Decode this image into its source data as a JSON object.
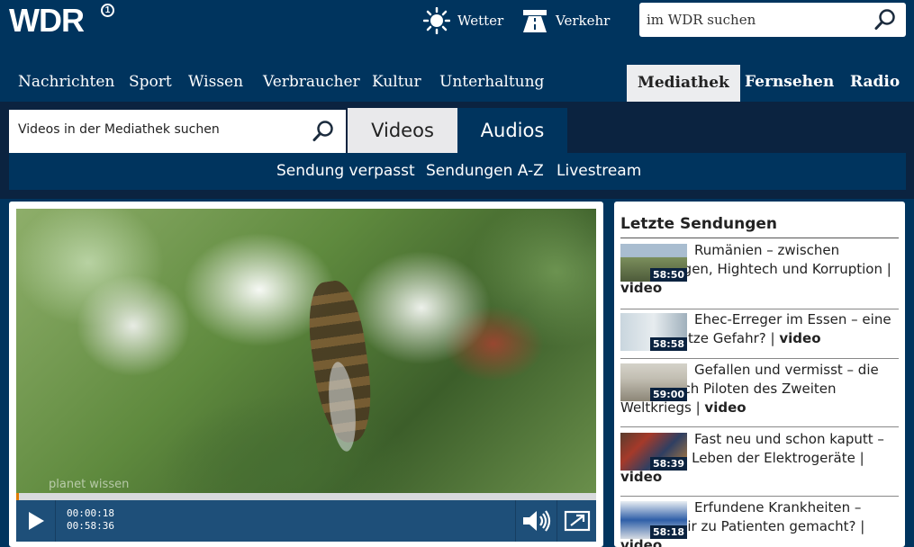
{
  "brand": {
    "logo": "WDR",
    "logo_mark": "1"
  },
  "top_links": [
    {
      "label": "Wetter",
      "icon": "sun-icon"
    },
    {
      "label": "Verkehr",
      "icon": "road-icon"
    }
  ],
  "site_search": {
    "value": "im WDR suchen",
    "icon": "search-icon"
  },
  "main_nav": {
    "items": [
      "Nachrichten",
      "Sport",
      "Wissen",
      "Verbraucher",
      "Kultur",
      "Unterhaltung"
    ],
    "mediathek": "Mediathek",
    "fernsehen": "Fernsehen",
    "radio": "Radio"
  },
  "mediathek": {
    "search_value": "Videos in der Mediathek suchen",
    "tab_videos": "Videos",
    "tab_audios": "Audios",
    "subnav": [
      "Sendung verpasst",
      "Sendungen A-Z",
      "Livestream"
    ]
  },
  "player": {
    "watermark": "planet wissen",
    "current_time": "00:00:18",
    "total_time": "00:58:36",
    "progress_fraction": 0.005,
    "accent_color": "#e07b00"
  },
  "sidebar": {
    "title": "Letzte Sendungen",
    "items": [
      {
        "title": "Rumänien – zwischen Pferdewagen, Hightech und Korruption",
        "sep": " | ",
        "kind": "video",
        "duration": "58:50"
      },
      {
        "title": "Ehec-Erreger im Essen – eine unterschätze Gefahr?",
        "sep": " | ",
        "kind": "video",
        "duration": "58:58"
      },
      {
        "title": "Gefallen und vermisst – die Suche nach Piloten des Zweiten Weltkriegs",
        "sep": " | ",
        "kind": "video",
        "duration": "59:00"
      },
      {
        "title": "Fast neu und schon kaputt – Das kurze Leben der Elektrogeräte",
        "sep": " | ",
        "kind": "video",
        "duration": "58:39"
      },
      {
        "title": "Erfundene Krankheiten – Werden wir zu Patienten gemacht?",
        "sep": " | ",
        "kind": "video",
        "duration": "58:18"
      }
    ]
  }
}
